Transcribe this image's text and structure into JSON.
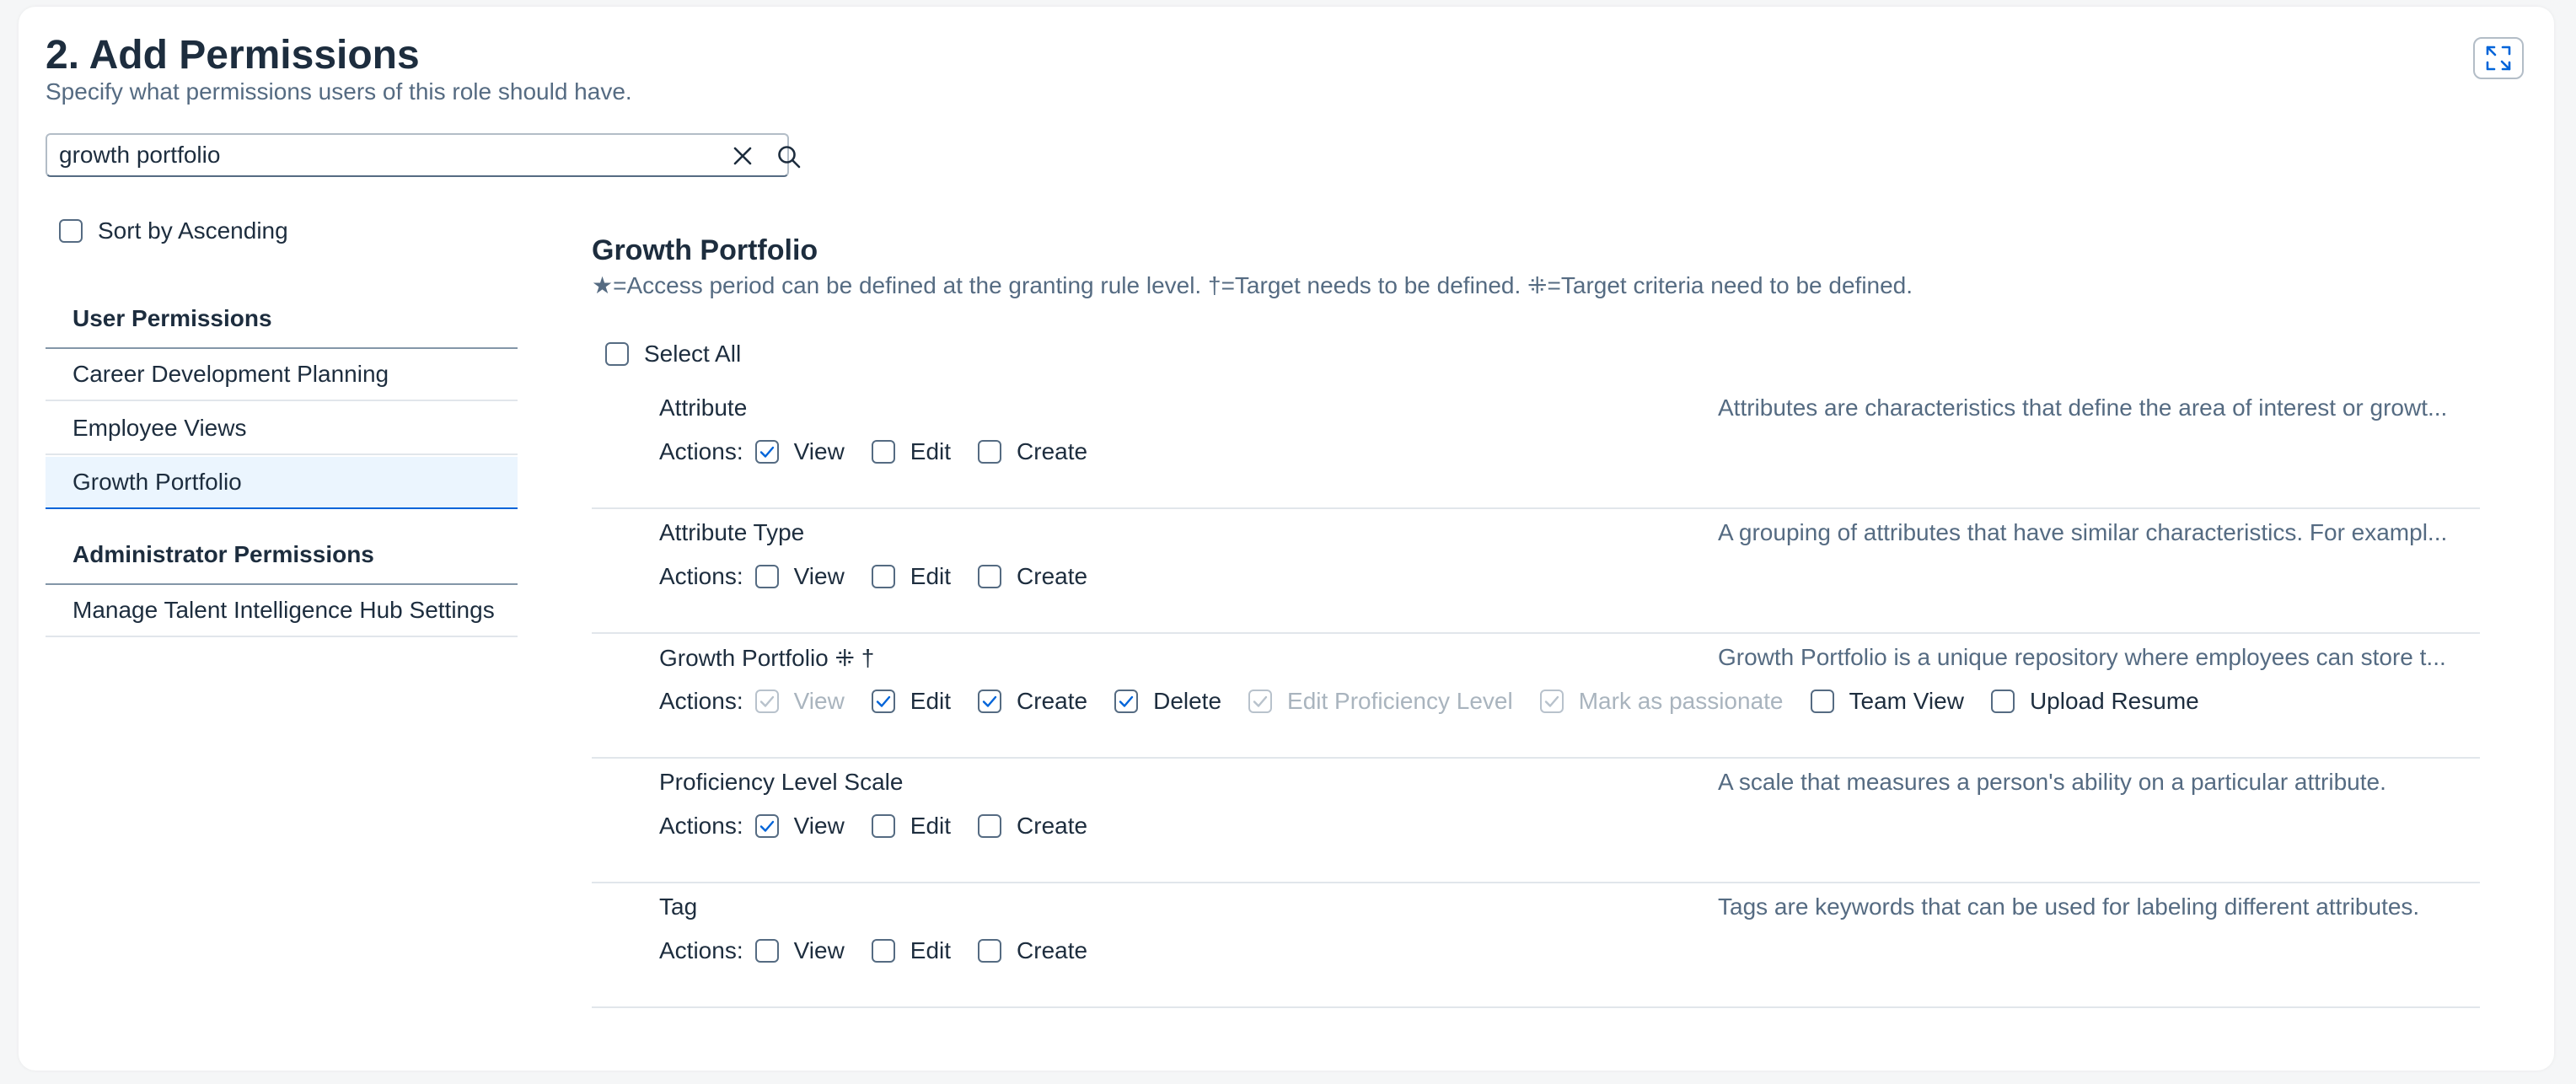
{
  "header": {
    "title": "2. Add Permissions",
    "subtitle": "Specify what permissions users of this role should have."
  },
  "search": {
    "value": "growth portfolio",
    "placeholder": "Search"
  },
  "sidebar": {
    "sort_label": "Sort by Ascending",
    "groups": [
      {
        "title": "User Permissions",
        "items": [
          {
            "label": "Career Development Planning",
            "selected": false
          },
          {
            "label": "Employee Views",
            "selected": false
          },
          {
            "label": "Growth Portfolio",
            "selected": true
          }
        ]
      },
      {
        "title": "Administrator Permissions",
        "items": [
          {
            "label": "Manage Talent Intelligence Hub Settings",
            "selected": false
          }
        ]
      }
    ]
  },
  "main": {
    "section_title": "Growth Portfolio",
    "legend": "★=Access period can be defined at the granting rule level.  †=Target needs to be defined.  ⁜=Target criteria need to be defined.",
    "select_all_label": "Select All",
    "actions_label": "Actions:",
    "permissions": [
      {
        "name": "Attribute",
        "description": "Attributes are characteristics that define the area of interest or growt...",
        "actions": [
          {
            "label": "View",
            "checked": true,
            "disabled": false
          },
          {
            "label": "Edit",
            "checked": false,
            "disabled": false
          },
          {
            "label": "Create",
            "checked": false,
            "disabled": false
          }
        ]
      },
      {
        "name": "Attribute Type",
        "description": "A grouping of attributes that have similar characteristics. For exampl...",
        "actions": [
          {
            "label": "View",
            "checked": false,
            "disabled": false
          },
          {
            "label": "Edit",
            "checked": false,
            "disabled": false
          },
          {
            "label": "Create",
            "checked": false,
            "disabled": false
          }
        ]
      },
      {
        "name": "Growth Portfolio ⁜ †",
        "description": "Growth Portfolio is a unique repository where employees can store t...",
        "actions": [
          {
            "label": "View",
            "checked": true,
            "disabled": true
          },
          {
            "label": "Edit",
            "checked": true,
            "disabled": false
          },
          {
            "label": "Create",
            "checked": true,
            "disabled": false
          },
          {
            "label": "Delete",
            "checked": true,
            "disabled": false
          },
          {
            "label": "Edit Proficiency Level",
            "checked": true,
            "disabled": true
          },
          {
            "label": "Mark as passionate",
            "checked": true,
            "disabled": true
          },
          {
            "label": "Team View",
            "checked": false,
            "disabled": false
          },
          {
            "label": "Upload Resume",
            "checked": false,
            "disabled": false
          }
        ]
      },
      {
        "name": "Proficiency Level Scale",
        "description": "A scale that measures a person's ability on a particular attribute.",
        "actions": [
          {
            "label": "View",
            "checked": true,
            "disabled": false
          },
          {
            "label": "Edit",
            "checked": false,
            "disabled": false
          },
          {
            "label": "Create",
            "checked": false,
            "disabled": false
          }
        ]
      },
      {
        "name": "Tag",
        "description": "Tags are keywords that can be used for labeling different attributes.",
        "actions": [
          {
            "label": "View",
            "checked": false,
            "disabled": false
          },
          {
            "label": "Edit",
            "checked": false,
            "disabled": false
          },
          {
            "label": "Create",
            "checked": false,
            "disabled": false
          }
        ]
      }
    ]
  },
  "icons": {
    "expand": "expand-icon",
    "clear": "close-icon",
    "search": "search-icon",
    "check": "check-icon"
  },
  "colors": {
    "accent": "#0064d9",
    "text": "#1d2d3e",
    "muted": "#556b82",
    "selected_bg": "#ebf5fe"
  }
}
